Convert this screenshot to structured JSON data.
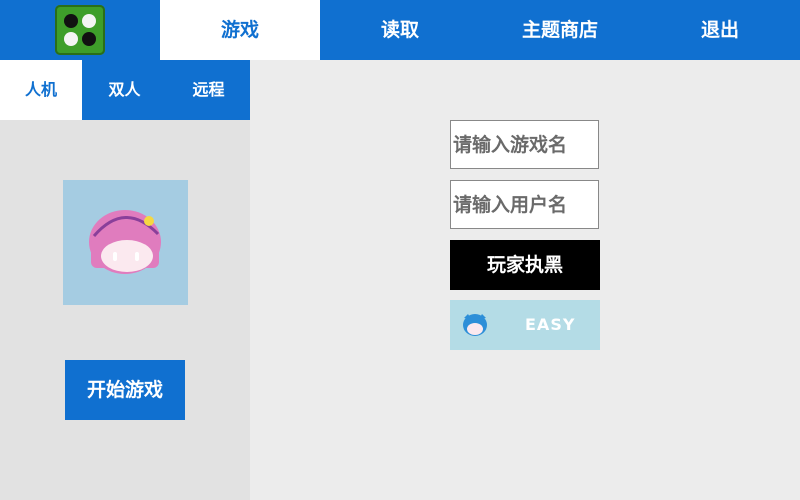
{
  "nav": {
    "tabs": [
      {
        "label": "游戏",
        "active": true
      },
      {
        "label": "读取",
        "active": false
      },
      {
        "label": "主题商店",
        "active": false
      },
      {
        "label": "退出",
        "active": false
      }
    ]
  },
  "logo_icon": "go-board-icon",
  "mode_tabs": [
    {
      "label": "人机",
      "active": true
    },
    {
      "label": "双人",
      "active": false
    },
    {
      "label": "远程",
      "active": false
    }
  ],
  "avatar_icon": "pink-hair-girl-avatar",
  "start_button": "开始游戏",
  "form": {
    "game_name_placeholder": "请输入游戏名",
    "user_name_placeholder": "请输入用户名",
    "side_button": "玩家执黑",
    "difficulty_label": "EASY",
    "difficulty_icon": "blue-hair-avatar-icon"
  },
  "colors": {
    "brand_blue": "#1070d0",
    "panel_gray": "#e2e2e2",
    "content_gray": "#ececec",
    "difficulty_bg": "#b4dce6"
  }
}
